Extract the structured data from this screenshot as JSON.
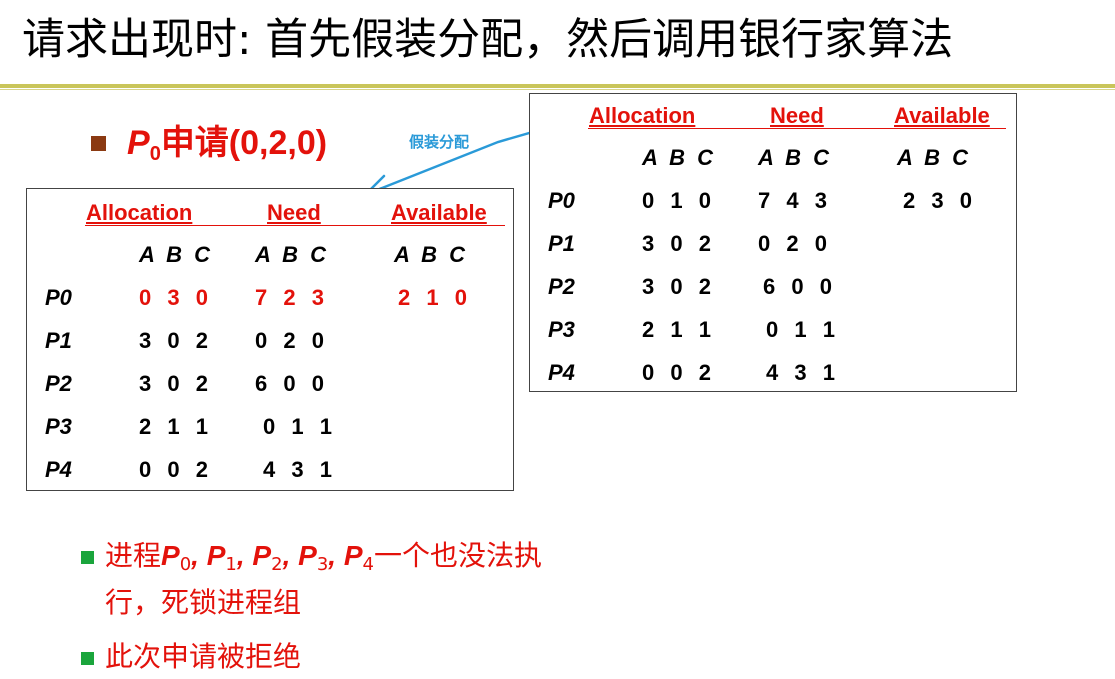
{
  "slide": {
    "title": "请求出现时: 首先假装分配，然后调用银行家算法",
    "request": {
      "process": "P",
      "sub": "0",
      "text": "申请(0,2,0)"
    },
    "arrow_label": "假装分配"
  },
  "left_table": {
    "headers": [
      "Allocation",
      "Need",
      "Available"
    ],
    "subheaders": [
      "A B C",
      "A B C",
      "A B C"
    ],
    "rows": [
      {
        "label": "P0",
        "allocation": "0 3 0",
        "need": "7 2 3",
        "available": "2 1 0"
      },
      {
        "label": "P1",
        "allocation": "3 0 2",
        "need": "0 2 0",
        "available": ""
      },
      {
        "label": "P2",
        "allocation": "3 0 2",
        "need": "6 0 0",
        "available": ""
      },
      {
        "label": "P3",
        "allocation": "2 1 1",
        "need": "0 1 1",
        "available": ""
      },
      {
        "label": "P4",
        "allocation": "0 0 2",
        "need": "4 3 1",
        "available": ""
      }
    ]
  },
  "right_table": {
    "headers": [
      "Allocation",
      "Need",
      "Available"
    ],
    "subheaders": [
      "A B C",
      "A B C",
      "A B C"
    ],
    "rows": [
      {
        "label": "P0",
        "allocation": "0 1 0",
        "need": "7 4 3",
        "available": "2 3 0"
      },
      {
        "label": "P1",
        "allocation": "3 0 2",
        "need": "0 2 0",
        "available": ""
      },
      {
        "label": "P2",
        "allocation": "3 0 2",
        "need": "6 0 0",
        "available": ""
      },
      {
        "label": "P3",
        "allocation": "2 1 1",
        "need": "0 1 1",
        "available": ""
      },
      {
        "label": "P4",
        "allocation": "0 0 2",
        "need": "4 3 1",
        "available": ""
      }
    ]
  },
  "bullets": {
    "b1_prefix": "进程",
    "procs": [
      {
        "p": "P",
        "s": "0"
      },
      {
        "p": "P",
        "s": "1"
      },
      {
        "p": "P",
        "s": "2"
      },
      {
        "p": "P",
        "s": "3"
      },
      {
        "p": "P",
        "s": "4"
      }
    ],
    "sep": ", ",
    "b1_suffix": "一个也没法执",
    "b1_line2": "行，死锁进程组",
    "b2": "此次申请被拒绝"
  },
  "colors": {
    "accent": "#e3120b",
    "rule": "#c9c55a",
    "arrow": "#2a9ad8",
    "bullet_brown": "#8b3a12",
    "bullet_green": "#1aa53c"
  }
}
